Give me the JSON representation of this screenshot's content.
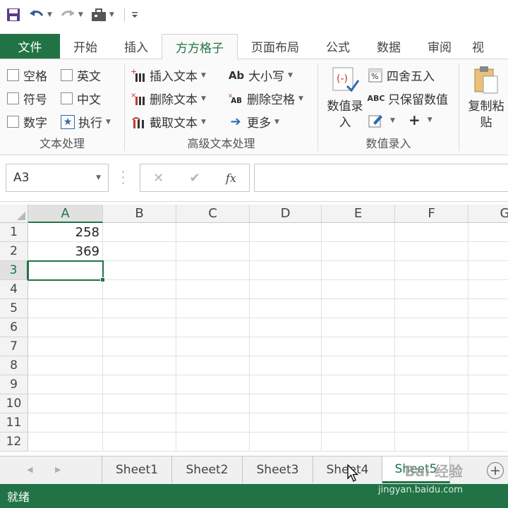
{
  "quick_access": {
    "items": [
      {
        "name": "save",
        "icon": "save-icon"
      },
      {
        "name": "undo",
        "icon": "undo-icon"
      },
      {
        "name": "redo",
        "icon": "redo-icon"
      },
      {
        "name": "tools",
        "icon": "toolbox-icon"
      },
      {
        "name": "customize",
        "icon": "customize-icon"
      }
    ]
  },
  "tabs": [
    "文件",
    "开始",
    "插入",
    "方方格子",
    "页面布局",
    "公式",
    "数据",
    "审阅",
    "视"
  ],
  "active_tab": "方方格子",
  "ribbon": {
    "text_group": {
      "label": "文本处理",
      "checkboxes": [
        "空格",
        "英文",
        "符号",
        "中文",
        "数字"
      ],
      "execute": "执行"
    },
    "advanced_group": {
      "label": "高级文本处理",
      "insert_text": "插入文本",
      "delete_text": "删除文本",
      "extract_text": "截取文本",
      "case": "大小写",
      "delete_space": "删除空格",
      "more": "更多"
    },
    "number_group": {
      "label": "数值录入",
      "number_entry": "数值录入",
      "round": "四舍五入",
      "keep_numbers": "只保留数值",
      "plus": "+"
    },
    "copy_paste": {
      "label": "复制粘贴"
    }
  },
  "formula_bar": {
    "name_box": "A3",
    "fx": "fx",
    "formula": ""
  },
  "grid": {
    "columns": [
      "A",
      "B",
      "C",
      "D",
      "E",
      "F",
      "G"
    ],
    "selected_column": "A",
    "rows": [
      "1",
      "2",
      "3",
      "4",
      "5",
      "6",
      "7",
      "8",
      "9",
      "10",
      "11",
      "12"
    ],
    "selected_row": "3",
    "cells": {
      "A1": "258",
      "A2": "369"
    }
  },
  "sheet_tabs": [
    "Sheet1",
    "Sheet2",
    "Sheet3",
    "Sheet4",
    "Sheet5"
  ],
  "active_sheet": "Sheet5",
  "status": "就绪",
  "watermark": {
    "text": "Bai 经验",
    "url": "jingyan.baidu.com"
  },
  "colors": {
    "accent": "#217346",
    "ribbon_bg": "#fafafa",
    "header_bg": "#f3f3f3"
  }
}
